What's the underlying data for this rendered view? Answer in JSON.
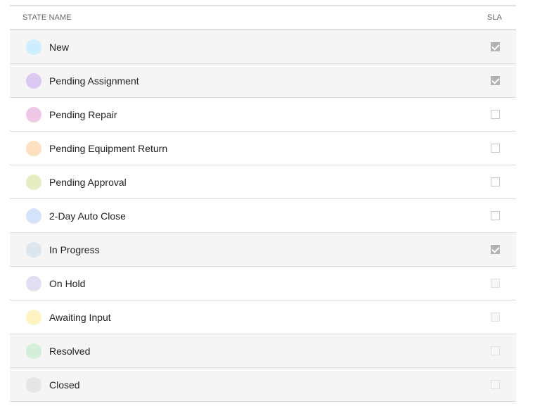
{
  "table": {
    "columns": {
      "state_name": "STATE NAME",
      "sla": "SLA"
    },
    "rows": [
      {
        "name": "New",
        "color": "#cdeefe",
        "sla_checked": true,
        "sla_disabled": false,
        "shaded": true
      },
      {
        "name": "Pending Assignment",
        "color": "#dcc8f3",
        "sla_checked": true,
        "sla_disabled": false,
        "shaded": true
      },
      {
        "name": "Pending Repair",
        "color": "#efc8e6",
        "sla_checked": false,
        "sla_disabled": false,
        "shaded": false
      },
      {
        "name": "Pending Equipment Return",
        "color": "#fde0bd",
        "sla_checked": false,
        "sla_disabled": false,
        "shaded": false
      },
      {
        "name": "Pending Approval",
        "color": "#e5eec3",
        "sla_checked": false,
        "sla_disabled": false,
        "shaded": false
      },
      {
        "name": "2-Day Auto Close",
        "color": "#d5e3fa",
        "sla_checked": false,
        "sla_disabled": false,
        "shaded": false
      },
      {
        "name": "In Progress",
        "color": "#dde6ef",
        "sla_checked": true,
        "sla_disabled": false,
        "shaded": true
      },
      {
        "name": "On Hold",
        "color": "#e1e0f3",
        "sla_checked": false,
        "sla_disabled": true,
        "shaded": false
      },
      {
        "name": "Awaiting Input",
        "color": "#fdf3c3",
        "sla_checked": false,
        "sla_disabled": true,
        "shaded": false
      },
      {
        "name": "Resolved",
        "color": "#d1f0d7",
        "sla_checked": false,
        "sla_disabled": true,
        "shaded": true
      },
      {
        "name": "Closed",
        "color": "#e5e5e5",
        "sla_checked": false,
        "sla_disabled": true,
        "shaded": true
      }
    ]
  }
}
